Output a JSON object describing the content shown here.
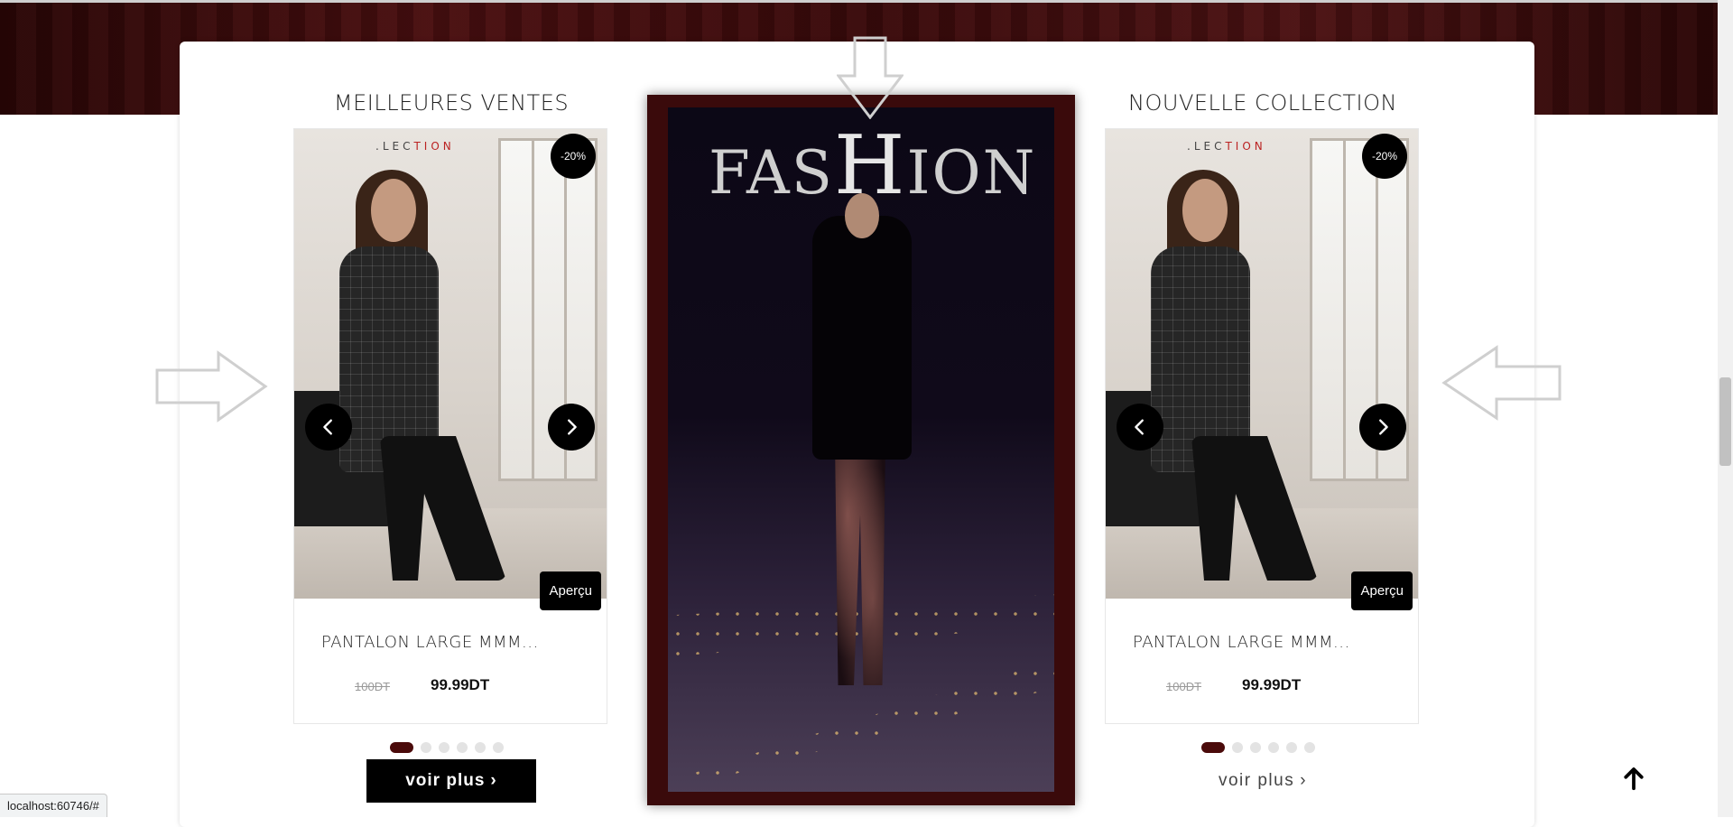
{
  "browser": {
    "status_url": "localhost:60746/#"
  },
  "sections": {
    "left": {
      "title": "MEILLEURES VENTES",
      "product": {
        "brand_text_dark": ".LEC",
        "brand_text_red": "TION",
        "discount_badge": "-20%",
        "preview_label": "Aperçu",
        "name": "PANTALON LARGE MMM...",
        "old_price": "100DT",
        "new_price": "99.99DT"
      },
      "dots_count": 6,
      "active_dot": 0,
      "voir_plus_label": "voir plus"
    },
    "center": {
      "video_title_part1": "FAS",
      "video_title_big": "H",
      "video_title_part2": "ION"
    },
    "right": {
      "title": "NOUVELLE COLLECTION",
      "product": {
        "brand_text_dark": ".LEC",
        "brand_text_red": "TION",
        "discount_badge": "-20%",
        "preview_label": "Aperçu",
        "name": "PANTALON LARGE MMM...",
        "old_price": "100DT",
        "new_price": "99.99DT"
      },
      "dots_count": 6,
      "active_dot": 0,
      "voir_plus_label": "voir plus"
    }
  },
  "icons": {
    "prev": "chevron-left-icon",
    "next": "chevron-right-icon",
    "back_to_top": "arrow-up-icon",
    "decor_arrows": [
      "arrow-right-outline-icon",
      "arrow-down-outline-icon",
      "arrow-left-outline-icon"
    ]
  },
  "colors": {
    "accent": "#4a0a0a",
    "band": "#3a0a0b",
    "button": "#000000"
  }
}
